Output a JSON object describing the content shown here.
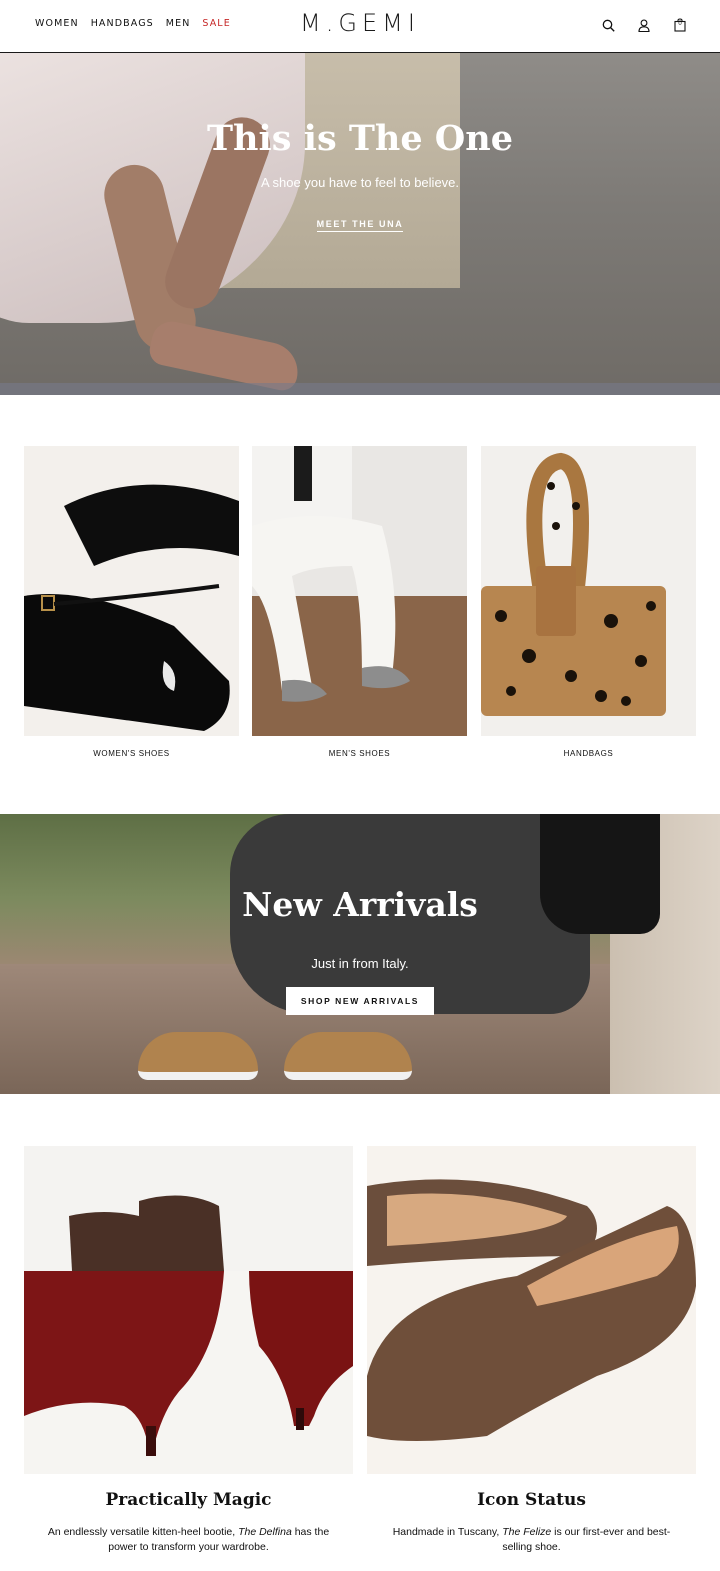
{
  "header": {
    "nav": [
      "WOMEN",
      "HANDBAGS",
      "MEN",
      "SALE"
    ],
    "logo": "M.GEMI",
    "icons": [
      "search-icon",
      "account-icon",
      "bag-icon"
    ],
    "bag_count": "0",
    "sale_color": "#c62828"
  },
  "hero": {
    "title": "This is The One",
    "subtitle": "A shoe you have to feel to believe.",
    "link": "MEET THE UNA"
  },
  "categories": [
    {
      "label": "WOMEN'S SHOES"
    },
    {
      "label": "MEN'S SHOES"
    },
    {
      "label": "HANDBAGS"
    }
  ],
  "arrivals": {
    "title": "New Arrivals",
    "subtitle": "Just in from Italy.",
    "button": "SHOP NEW ARRIVALS"
  },
  "features": [
    {
      "title": "Practically Magic",
      "desc_before": "An endlessly versatile kitten-heel bootie, ",
      "desc_em": "The Delfina",
      "desc_after": " has the power to transform your wardrobe."
    },
    {
      "title": "Icon Status",
      "desc_before": "Handmade in Tuscany, ",
      "desc_em": "The Felize",
      "desc_after": " is our first-ever and best-selling shoe."
    }
  ]
}
